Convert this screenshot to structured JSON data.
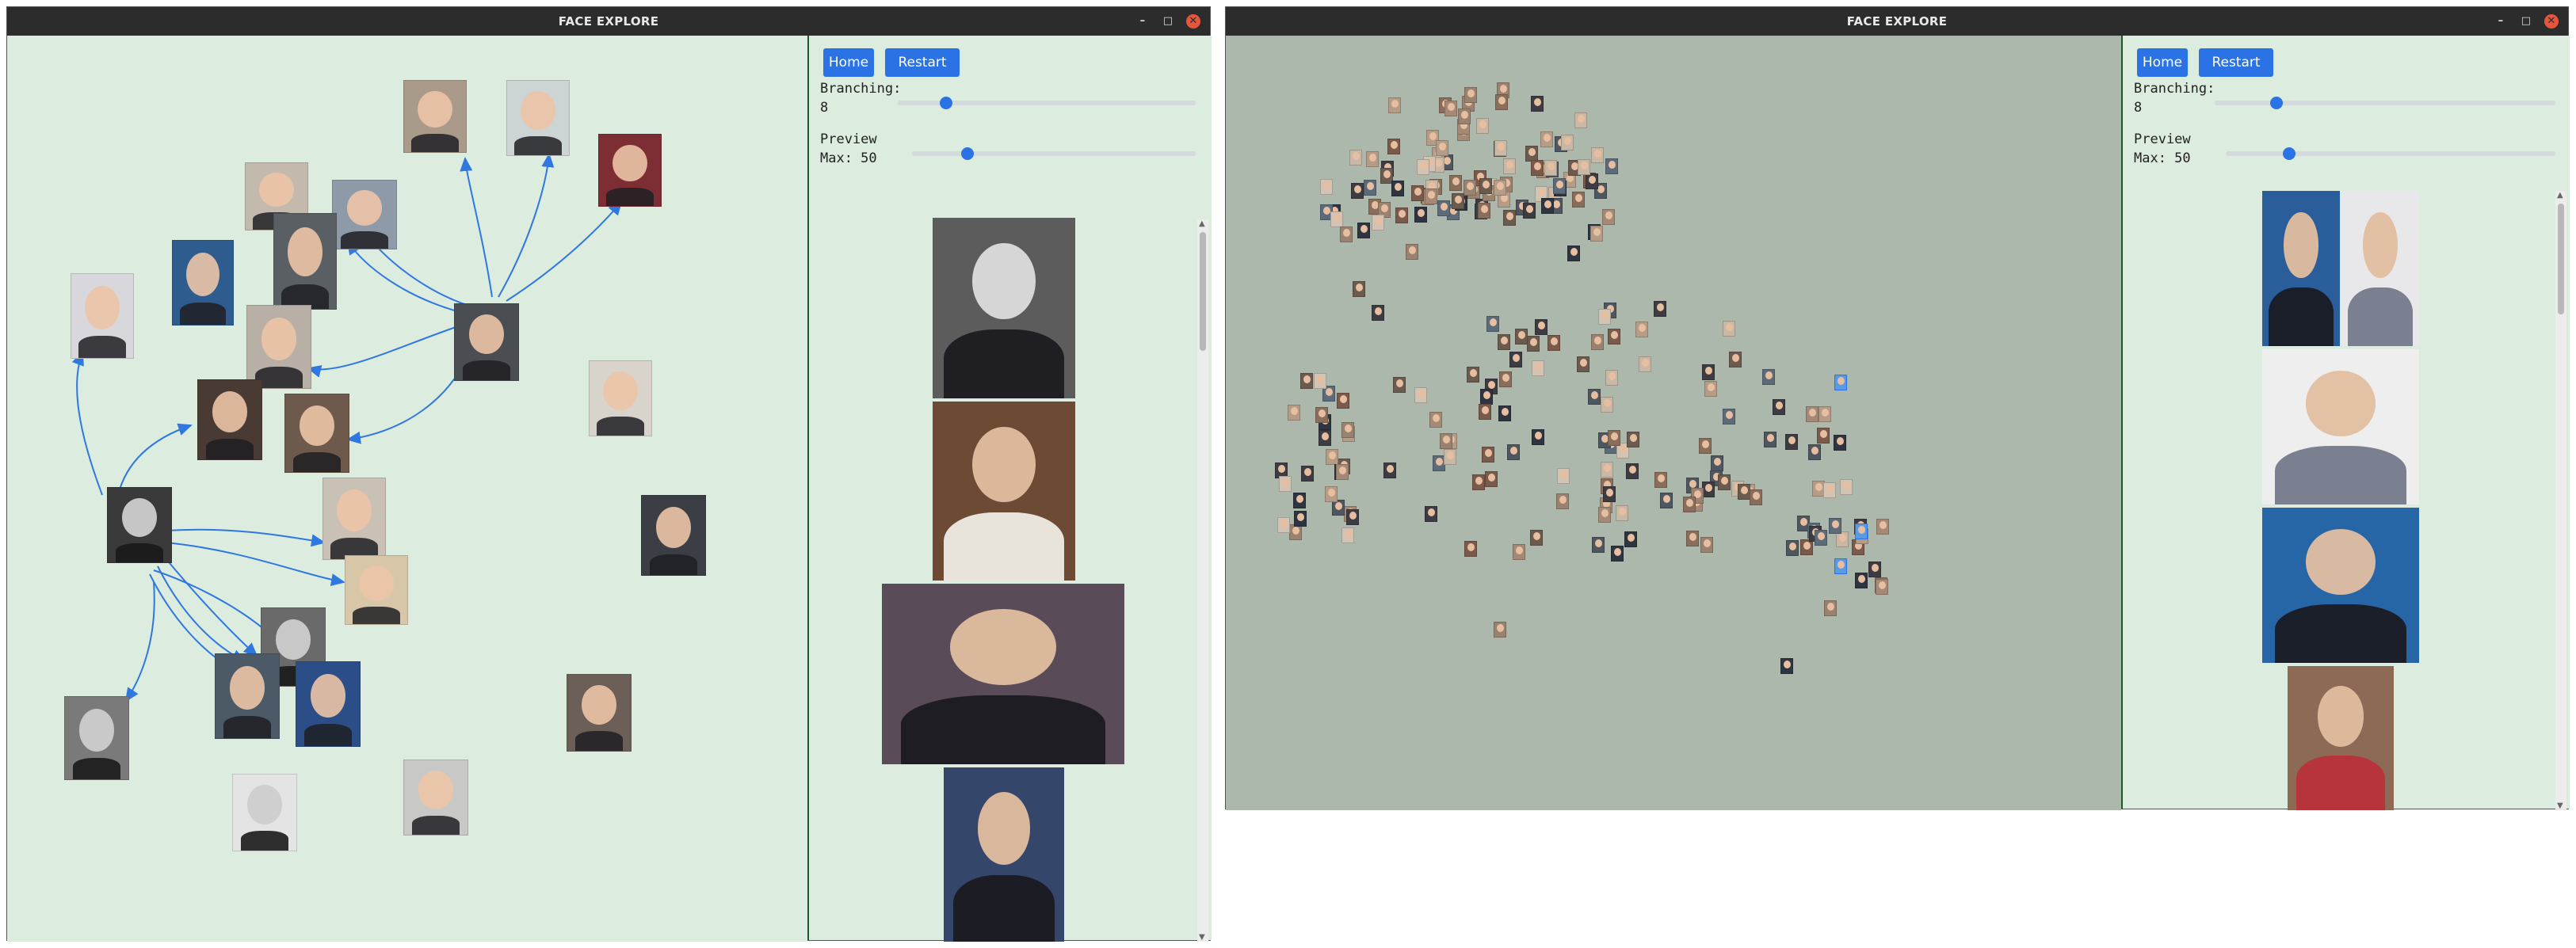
{
  "left_window": {
    "title": "FACE EXPLORE",
    "controls": {
      "minimize": "–",
      "maximize": "□",
      "close": "✕"
    },
    "home_label": "Home",
    "restart_label": "Restart",
    "branching_label": "Branching:",
    "branching_value": "8",
    "preview_label": "Preview",
    "preview_max": "Max: 50",
    "branching_slider": 0.12,
    "preview_slider": 0.19
  },
  "right_window": {
    "title": "FACE EXPLORE",
    "controls": {
      "minimize": "–",
      "maximize": "□",
      "close": "✕"
    },
    "home_label": "Home",
    "restart_label": "Restart",
    "branching_label": "Branching:",
    "branching_value": "8",
    "preview_label": "Preview",
    "preview_max": "Max: 50",
    "branching_slider": 0.12,
    "preview_slider": 0.19
  },
  "colors": {
    "accent": "#2b73e4",
    "left_canvas": "#dcecdf",
    "right_canvas": "#adb8ad",
    "titlebar": "#2c2c2c",
    "close": "#e8553b"
  }
}
